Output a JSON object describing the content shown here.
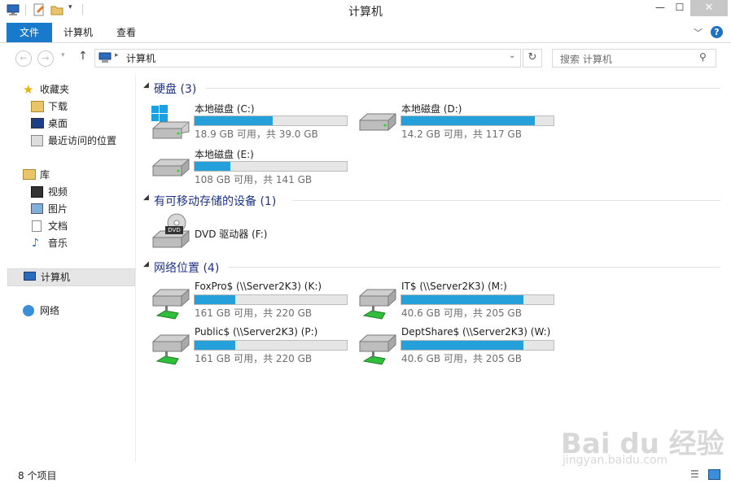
{
  "window": {
    "title": "计算机"
  },
  "ribbon": {
    "tabs": [
      "文件",
      "计算机",
      "查看"
    ]
  },
  "address": {
    "path": "计算机"
  },
  "search": {
    "placeholder": "搜索 计算机"
  },
  "sidebar": {
    "favorites": {
      "label": "收藏夹",
      "items": [
        "下载",
        "桌面",
        "最近访问的位置"
      ]
    },
    "libraries": {
      "label": "库",
      "items": [
        "视频",
        "图片",
        "文档",
        "音乐"
      ]
    },
    "computer": "计算机",
    "network": "网络"
  },
  "groups": {
    "hard_disks": {
      "header": "硬盘 (3)",
      "drives": [
        {
          "name": "本地磁盘 (C:)",
          "size": "18.9 GB 可用，共 39.0 GB",
          "used_fraction": 0.515
        },
        {
          "name": "本地磁盘 (D:)",
          "size": "14.2 GB 可用，共 117 GB",
          "used_fraction": 0.879
        },
        {
          "name": "本地磁盘 (E:)",
          "size": "108 GB 可用，共 141 GB",
          "used_fraction": 0.234
        }
      ]
    },
    "removable": {
      "header": "有可移动存储的设备 (1)",
      "drives": [
        {
          "name": "DVD 驱动器 (F:)",
          "badge": "DVD"
        }
      ]
    },
    "network": {
      "header": "网络位置 (4)",
      "drives": [
        {
          "name": "FoxPro$ (\\\\Server2K3) (K:)",
          "size": "161 GB 可用，共 220 GB",
          "used_fraction": 0.268
        },
        {
          "name": "IT$ (\\\\Server2K3) (M:)",
          "size": "40.6 GB 可用，共 205 GB",
          "used_fraction": 0.802
        },
        {
          "name": "Public$ (\\\\Server2K3) (P:)",
          "size": "161 GB 可用，共 220 GB",
          "used_fraction": 0.268
        },
        {
          "name": "DeptShare$ (\\\\Server2K3) (W:)",
          "size": "40.6 GB 可用，共 205 GB",
          "used_fraction": 0.802
        }
      ]
    }
  },
  "status": {
    "items": "8 个项目"
  },
  "watermark": {
    "brand": "Bai du 经验",
    "url": "jingyan.baidu.com"
  },
  "colors": {
    "accent": "#1979ca",
    "bar_fill": "#26a0da",
    "group_header": "#1e3287"
  }
}
